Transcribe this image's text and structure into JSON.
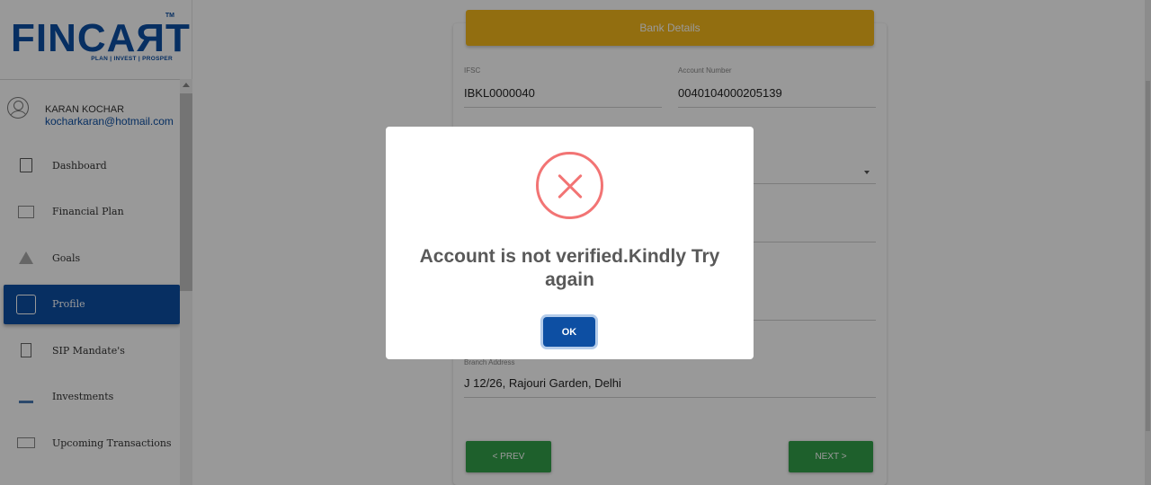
{
  "brand": {
    "logo_text": "FINCAЯT",
    "tagline": "PLAN | INVEST | PROSPER",
    "tm": "TM"
  },
  "user": {
    "name": "KARAN KOCHAR",
    "email": "kocharkaran@hotmail.com"
  },
  "sidebar": {
    "items": [
      {
        "label": "Dashboard",
        "icon": "clipboard-icon"
      },
      {
        "label": "Financial Plan",
        "icon": "chart-icon"
      },
      {
        "label": "Goals",
        "icon": "mountain-icon"
      },
      {
        "label": "Profile",
        "icon": "profile-icon",
        "active": true
      },
      {
        "label": "SIP Mandate's",
        "icon": "document-icon"
      },
      {
        "label": "Investments",
        "icon": "investments-icon"
      },
      {
        "label": "Upcoming Transactions",
        "icon": "card-icon"
      }
    ]
  },
  "bank_form": {
    "header": "Bank Details",
    "ifsc_label": "IFSC",
    "ifsc_value": "IBKL0000040",
    "account_label": "Account Number",
    "account_value": "0040104000205139",
    "branch_address_label": "Branch Address",
    "branch_address_value": "J 12/26, Rajouri Garden, Delhi",
    "prev_label": "< PREV",
    "next_label": "NEXT >"
  },
  "modal": {
    "message": "Account is not verified.Kindly Try again",
    "ok_label": "OK"
  },
  "colors": {
    "brand_blue": "#0d4fa3",
    "header_yellow": "#f4b81c",
    "button_green": "#33a04a",
    "error_red": "#f27474"
  }
}
